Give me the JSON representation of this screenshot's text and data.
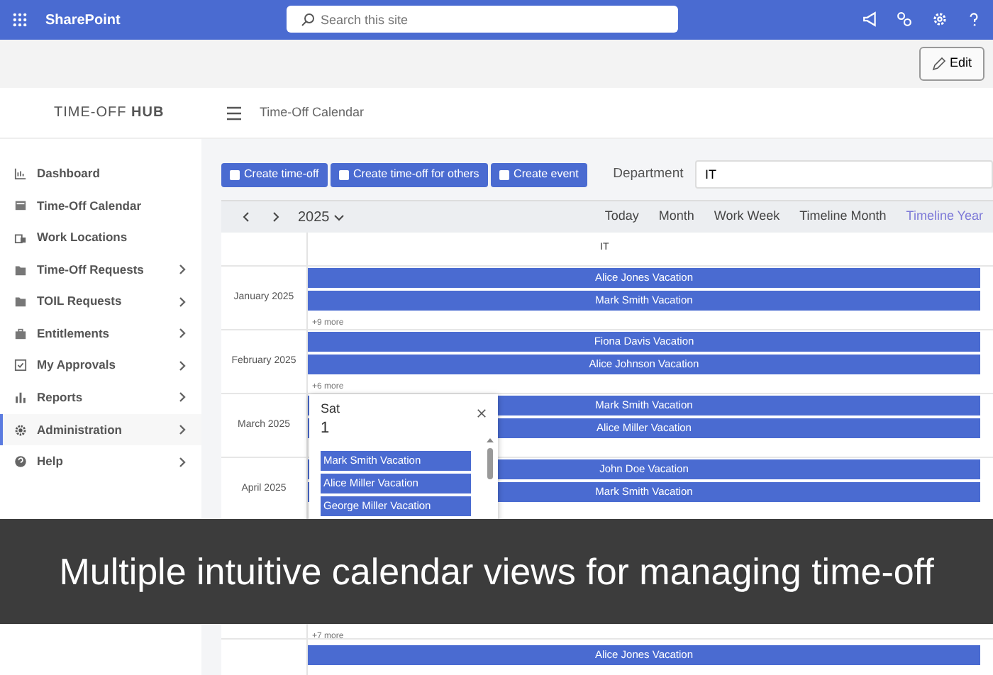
{
  "suite_bar": {
    "app_name": "SharePoint",
    "search_placeholder": "Search this site"
  },
  "command_bar": {
    "edit_label": "Edit"
  },
  "site_header": {
    "logo_light": "TIME-OFF",
    "logo_bold": "HUB",
    "page_title": "Time-Off Calendar"
  },
  "sidebar": {
    "items": [
      {
        "label": "Dashboard",
        "has_submenu": false,
        "selected": false
      },
      {
        "label": "Time-Off Calendar",
        "has_submenu": false,
        "selected": false
      },
      {
        "label": "Work Locations",
        "has_submenu": false,
        "selected": false
      },
      {
        "label": "Time-Off Requests",
        "has_submenu": true,
        "selected": false
      },
      {
        "label": "TOIL Requests",
        "has_submenu": true,
        "selected": false
      },
      {
        "label": "Entitlements",
        "has_submenu": true,
        "selected": false
      },
      {
        "label": "My Approvals",
        "has_submenu": true,
        "selected": false
      },
      {
        "label": "Reports",
        "has_submenu": true,
        "selected": false
      },
      {
        "label": "Administration",
        "has_submenu": true,
        "selected": true
      },
      {
        "label": "Help",
        "has_submenu": true,
        "selected": false
      }
    ]
  },
  "actions": [
    "Create time-off",
    "Create time-off for others",
    "Create event"
  ],
  "department": {
    "label": "Department",
    "value": "IT"
  },
  "calendar": {
    "year": "2025",
    "views": [
      {
        "label": "Today",
        "selected": false
      },
      {
        "label": "Month",
        "selected": false
      },
      {
        "label": "Work Week",
        "selected": false
      },
      {
        "label": "Timeline Month",
        "selected": false
      },
      {
        "label": "Timeline Year",
        "selected": true
      }
    ],
    "resource": "IT",
    "months": [
      {
        "label": "January 2025",
        "events": [
          "Alice Jones Vacation",
          "Mark Smith Vacation"
        ],
        "more": "+9 more"
      },
      {
        "label": "February 2025",
        "events": [
          "Fiona Davis Vacation",
          "Alice Johnson Vacation"
        ],
        "more": "+6 more"
      },
      {
        "label": "March 2025",
        "events": [
          "Mark Smith Vacation",
          "Alice Miller Vacation"
        ]
      },
      {
        "label": "April 2025",
        "events": [
          "John Doe Vacation",
          "Mark Smith Vacation"
        ]
      }
    ],
    "below_caption": {
      "more": "+7 more",
      "events": [
        "Alice Jones Vacation"
      ]
    }
  },
  "day_popup": {
    "weekday": "Sat",
    "day": "1",
    "events": [
      "Mark Smith Vacation",
      "Alice Miller Vacation",
      "George Miller Vacation"
    ]
  },
  "caption": "Multiple intuitive calendar views for managing time-off"
}
